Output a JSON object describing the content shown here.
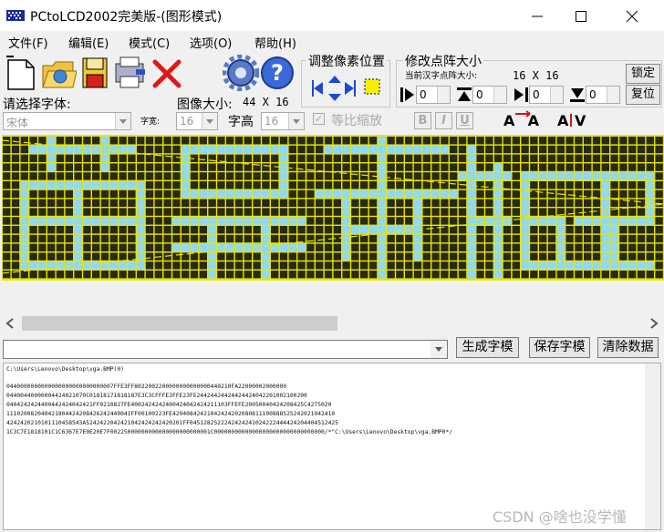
{
  "window": {
    "title": "PCtoLCD2002完美版-(图形模式)"
  },
  "menu": {
    "items": [
      "文件(F)",
      "编辑(E)",
      "模式(C)",
      "选项(O)",
      "帮助(H)"
    ]
  },
  "toolbar": {
    "font_label": "请选择字体:",
    "font_value": "宋体",
    "width_label": "字宽:",
    "width_value": "16",
    "height_label": "字高",
    "height_value": "16",
    "image_size_label": "图像大小:",
    "image_size_value": "44 X 16",
    "ratio_label": "等比缩放",
    "bold": "B",
    "italic": "I",
    "underline": "U"
  },
  "adjust": {
    "title": "调整像素位置"
  },
  "resize": {
    "title": "修改点阵大小",
    "current_label": "当前汉字点阵大小:",
    "current_value": "16 X 16",
    "lock_button": "锁定",
    "restore_button": "复位",
    "spins": [
      "0",
      "0",
      "0",
      "0"
    ]
  },
  "actions": {
    "generate": "生成字模",
    "save": "保存字模",
    "clear": "清除数据"
  },
  "output": {
    "lines": [
      "C:\\Users\\Lenovo\\Desktop\\vga.BMP(0)",
      "",
      "0440000000000000000000000000007FFE3FF8022002200000000000000440210FA22000002000000",
      "04400440000004424021070C01818171818187E3C3CFFFE3FFE23FE24424424424424424042201002100200",
      "0404242424400442424042421FF0210827FE4002424242400424042424211103FFEFE20050040424208425C4275020",
      "111020082040421804424208426242440041FF00100223FE42040842421042424202080811100888525242021042410",
      "4242420210101110458543A5242422042421042424242420201FF0451282522242424241024222444424204404512425",
      "1C3C7E1818101C1C6367E7E0E20E7F00225000000000000000000000001C00000000000000000000000000000000/*\"C:\\Users\\Lenovo\\Desktop\\vga.BMP0*/"
    ]
  },
  "watermark": "CSDN @啥也没学懂",
  "colors": {
    "matrix_bg": "#2a2a12",
    "matrix_on": "#8fd8f8",
    "matrix_grid": "#e6e600",
    "guide": "#e6e600"
  }
}
